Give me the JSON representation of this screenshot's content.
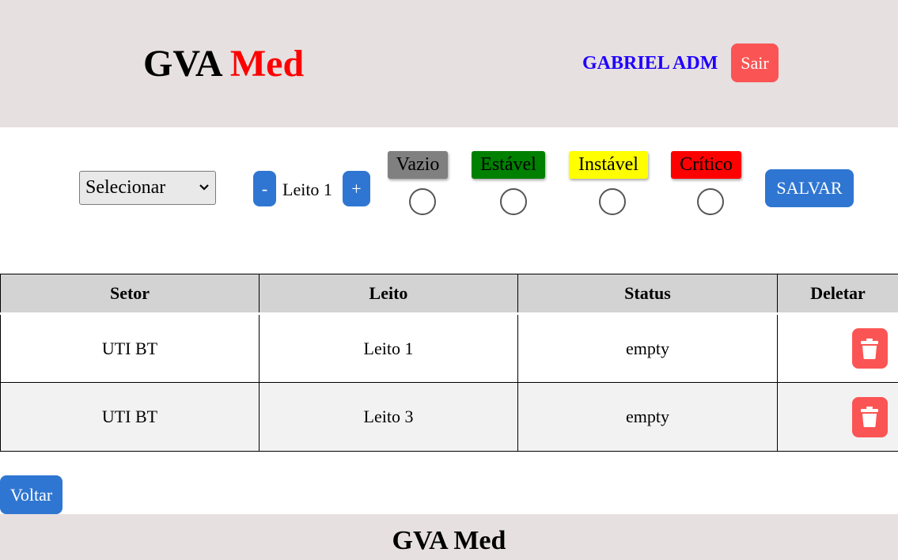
{
  "header": {
    "brand_part1": "GVA ",
    "brand_part2": "Med",
    "user_name": "GABRIEL ADM",
    "logout_label": "Sair"
  },
  "controls": {
    "sector_select": {
      "selected": "Selecionar"
    },
    "bed_stepper": {
      "minus_label": "-",
      "value_label": "Leito 1",
      "plus_label": "+"
    },
    "status_options": [
      {
        "label": "Vazio",
        "color": "#808080"
      },
      {
        "label": "Estável",
        "color": "#008000"
      },
      {
        "label": "Instável",
        "color": "#ffff00"
      },
      {
        "label": "Crítico",
        "color": "#ff0000"
      }
    ],
    "save_label": "SALVAR"
  },
  "table": {
    "headers": [
      "Setor",
      "Leito",
      "Status",
      "Deletar"
    ],
    "rows": [
      {
        "setor": "UTI BT",
        "leito": "Leito 1",
        "status": "empty"
      },
      {
        "setor": "UTI BT",
        "leito": "Leito 3",
        "status": "empty"
      }
    ]
  },
  "back_label": "Voltar",
  "footer": {
    "title": "GVA Med"
  },
  "colors": {
    "header_bg": "#e6e0e0",
    "primary_button": "#2f76d2",
    "danger_button": "#fb5454",
    "user_name": "#1f00ff",
    "brand_accent": "#ff0000"
  },
  "icons": {
    "select_arrow": "chevron-down-icon",
    "delete": "trash-icon"
  }
}
